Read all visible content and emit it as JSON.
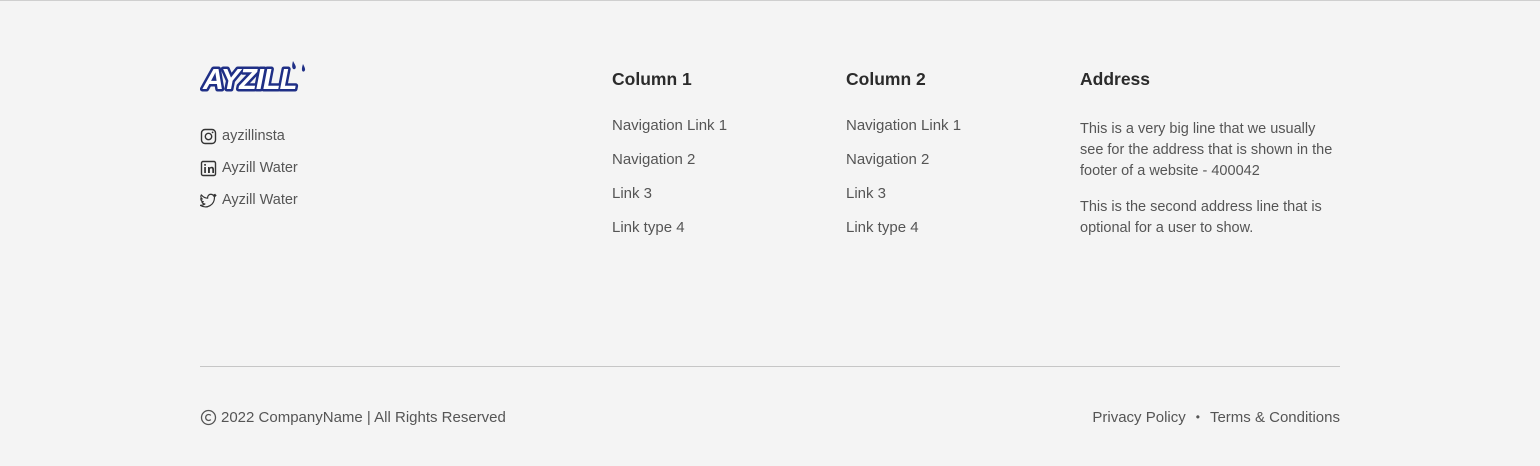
{
  "brand": {
    "logo_text": "AYZILL",
    "logo_color": "#1f2f86"
  },
  "social": [
    {
      "icon": "instagram-icon",
      "label": "ayzillinsta"
    },
    {
      "icon": "linkedin-icon",
      "label": "Ayzill Water"
    },
    {
      "icon": "twitter-icon",
      "label": "Ayzill Water"
    }
  ],
  "columns": [
    {
      "heading": "Column 1",
      "links": [
        "Navigation Link 1",
        "Navigation 2",
        "Link 3",
        "Link type 4"
      ]
    },
    {
      "heading": "Column 2",
      "links": [
        "Navigation Link 1",
        "Navigation 2",
        "Link 3",
        "Link type 4"
      ]
    }
  ],
  "address": {
    "heading": "Address",
    "lines": [
      "This is a very big line that we usually see for the address that is shown in the footer of a website - 400042",
      "This is the second address line that is optional for a user to show."
    ]
  },
  "bottom": {
    "copyright": "2022 CompanyName | All Rights Reserved",
    "privacy": "Privacy Policy",
    "separator": "•",
    "terms": "Terms & Conditions"
  },
  "colors": {
    "background": "#f4f4f4",
    "text": "#555555",
    "heading": "#2b2b2b",
    "divider": "#c6c6c6"
  }
}
